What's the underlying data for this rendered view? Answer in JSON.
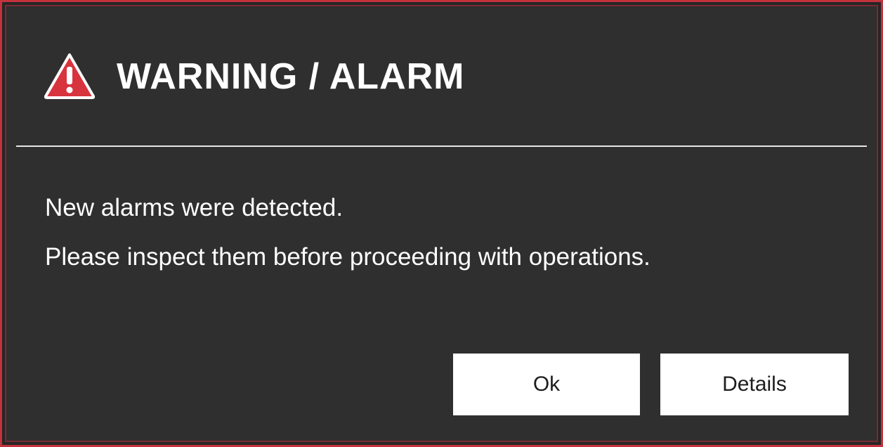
{
  "dialog": {
    "icon": "warning-triangle-icon",
    "title": "WARNING / ALARM",
    "message_lines": [
      "New alarms were detected.",
      "Please inspect them before proceeding with operations."
    ],
    "buttons": {
      "ok_label": "Ok",
      "details_label": "Details"
    }
  },
  "colors": {
    "background": "#2f2f2f",
    "border": "#c4323c",
    "icon": "#d8343e",
    "text": "#ffffff",
    "button_bg": "#ffffff",
    "button_text": "#1d1d1d"
  }
}
